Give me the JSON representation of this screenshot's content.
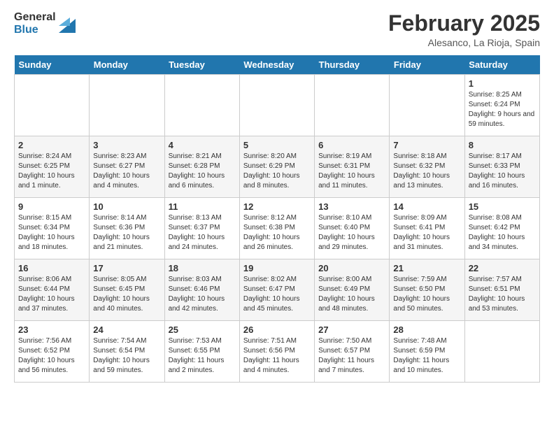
{
  "logo": {
    "general": "General",
    "blue": "Blue"
  },
  "title": "February 2025",
  "subtitle": "Alesanco, La Rioja, Spain",
  "headers": [
    "Sunday",
    "Monday",
    "Tuesday",
    "Wednesday",
    "Thursday",
    "Friday",
    "Saturday"
  ],
  "weeks": [
    [
      {
        "day": "",
        "sunrise": "",
        "sunset": "",
        "daylight": ""
      },
      {
        "day": "",
        "sunrise": "",
        "sunset": "",
        "daylight": ""
      },
      {
        "day": "",
        "sunrise": "",
        "sunset": "",
        "daylight": ""
      },
      {
        "day": "",
        "sunrise": "",
        "sunset": "",
        "daylight": ""
      },
      {
        "day": "",
        "sunrise": "",
        "sunset": "",
        "daylight": ""
      },
      {
        "day": "",
        "sunrise": "",
        "sunset": "",
        "daylight": ""
      },
      {
        "day": "1",
        "sunrise": "Sunrise: 8:25 AM",
        "sunset": "Sunset: 6:24 PM",
        "daylight": "Daylight: 9 hours and 59 minutes."
      }
    ],
    [
      {
        "day": "2",
        "sunrise": "Sunrise: 8:24 AM",
        "sunset": "Sunset: 6:25 PM",
        "daylight": "Daylight: 10 hours and 1 minute."
      },
      {
        "day": "3",
        "sunrise": "Sunrise: 8:23 AM",
        "sunset": "Sunset: 6:27 PM",
        "daylight": "Daylight: 10 hours and 4 minutes."
      },
      {
        "day": "4",
        "sunrise": "Sunrise: 8:21 AM",
        "sunset": "Sunset: 6:28 PM",
        "daylight": "Daylight: 10 hours and 6 minutes."
      },
      {
        "day": "5",
        "sunrise": "Sunrise: 8:20 AM",
        "sunset": "Sunset: 6:29 PM",
        "daylight": "Daylight: 10 hours and 8 minutes."
      },
      {
        "day": "6",
        "sunrise": "Sunrise: 8:19 AM",
        "sunset": "Sunset: 6:31 PM",
        "daylight": "Daylight: 10 hours and 11 minutes."
      },
      {
        "day": "7",
        "sunrise": "Sunrise: 8:18 AM",
        "sunset": "Sunset: 6:32 PM",
        "daylight": "Daylight: 10 hours and 13 minutes."
      },
      {
        "day": "8",
        "sunrise": "Sunrise: 8:17 AM",
        "sunset": "Sunset: 6:33 PM",
        "daylight": "Daylight: 10 hours and 16 minutes."
      }
    ],
    [
      {
        "day": "9",
        "sunrise": "Sunrise: 8:15 AM",
        "sunset": "Sunset: 6:34 PM",
        "daylight": "Daylight: 10 hours and 18 minutes."
      },
      {
        "day": "10",
        "sunrise": "Sunrise: 8:14 AM",
        "sunset": "Sunset: 6:36 PM",
        "daylight": "Daylight: 10 hours and 21 minutes."
      },
      {
        "day": "11",
        "sunrise": "Sunrise: 8:13 AM",
        "sunset": "Sunset: 6:37 PM",
        "daylight": "Daylight: 10 hours and 24 minutes."
      },
      {
        "day": "12",
        "sunrise": "Sunrise: 8:12 AM",
        "sunset": "Sunset: 6:38 PM",
        "daylight": "Daylight: 10 hours and 26 minutes."
      },
      {
        "day": "13",
        "sunrise": "Sunrise: 8:10 AM",
        "sunset": "Sunset: 6:40 PM",
        "daylight": "Daylight: 10 hours and 29 minutes."
      },
      {
        "day": "14",
        "sunrise": "Sunrise: 8:09 AM",
        "sunset": "Sunset: 6:41 PM",
        "daylight": "Daylight: 10 hours and 31 minutes."
      },
      {
        "day": "15",
        "sunrise": "Sunrise: 8:08 AM",
        "sunset": "Sunset: 6:42 PM",
        "daylight": "Daylight: 10 hours and 34 minutes."
      }
    ],
    [
      {
        "day": "16",
        "sunrise": "Sunrise: 8:06 AM",
        "sunset": "Sunset: 6:44 PM",
        "daylight": "Daylight: 10 hours and 37 minutes."
      },
      {
        "day": "17",
        "sunrise": "Sunrise: 8:05 AM",
        "sunset": "Sunset: 6:45 PM",
        "daylight": "Daylight: 10 hours and 40 minutes."
      },
      {
        "day": "18",
        "sunrise": "Sunrise: 8:03 AM",
        "sunset": "Sunset: 6:46 PM",
        "daylight": "Daylight: 10 hours and 42 minutes."
      },
      {
        "day": "19",
        "sunrise": "Sunrise: 8:02 AM",
        "sunset": "Sunset: 6:47 PM",
        "daylight": "Daylight: 10 hours and 45 minutes."
      },
      {
        "day": "20",
        "sunrise": "Sunrise: 8:00 AM",
        "sunset": "Sunset: 6:49 PM",
        "daylight": "Daylight: 10 hours and 48 minutes."
      },
      {
        "day": "21",
        "sunrise": "Sunrise: 7:59 AM",
        "sunset": "Sunset: 6:50 PM",
        "daylight": "Daylight: 10 hours and 50 minutes."
      },
      {
        "day": "22",
        "sunrise": "Sunrise: 7:57 AM",
        "sunset": "Sunset: 6:51 PM",
        "daylight": "Daylight: 10 hours and 53 minutes."
      }
    ],
    [
      {
        "day": "23",
        "sunrise": "Sunrise: 7:56 AM",
        "sunset": "Sunset: 6:52 PM",
        "daylight": "Daylight: 10 hours and 56 minutes."
      },
      {
        "day": "24",
        "sunrise": "Sunrise: 7:54 AM",
        "sunset": "Sunset: 6:54 PM",
        "daylight": "Daylight: 10 hours and 59 minutes."
      },
      {
        "day": "25",
        "sunrise": "Sunrise: 7:53 AM",
        "sunset": "Sunset: 6:55 PM",
        "daylight": "Daylight: 11 hours and 2 minutes."
      },
      {
        "day": "26",
        "sunrise": "Sunrise: 7:51 AM",
        "sunset": "Sunset: 6:56 PM",
        "daylight": "Daylight: 11 hours and 4 minutes."
      },
      {
        "day": "27",
        "sunrise": "Sunrise: 7:50 AM",
        "sunset": "Sunset: 6:57 PM",
        "daylight": "Daylight: 11 hours and 7 minutes."
      },
      {
        "day": "28",
        "sunrise": "Sunrise: 7:48 AM",
        "sunset": "Sunset: 6:59 PM",
        "daylight": "Daylight: 11 hours and 10 minutes."
      },
      {
        "day": "",
        "sunrise": "",
        "sunset": "",
        "daylight": ""
      }
    ]
  ]
}
